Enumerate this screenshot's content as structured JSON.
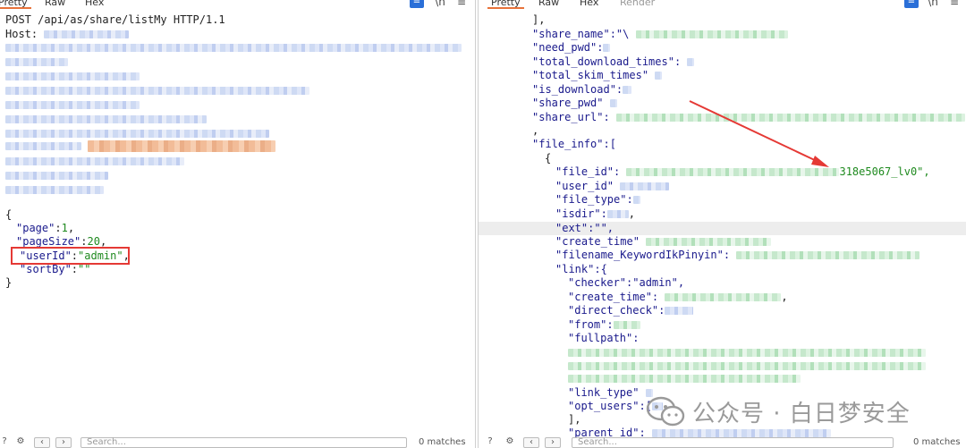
{
  "left_pane": {
    "tabs": [
      "Pretty",
      "Raw",
      "Hex"
    ],
    "active_tab": "Pretty",
    "request_line": "POST /api/as/share/listMy HTTP/1.1",
    "host_label": "Host:",
    "body": {
      "open_brace": "{",
      "close_brace": "}",
      "fields": [
        {
          "key": "\"page\"",
          "sep": ":",
          "value": "1",
          "tail": ","
        },
        {
          "key": "\"pageSize\"",
          "sep": ":",
          "value": "20",
          "tail": ","
        },
        {
          "key": "\"userId\"",
          "sep": ":",
          "value": "\"admin\"",
          "tail": ","
        },
        {
          "key": "\"sortBy\"",
          "sep": ":",
          "value": "\"\"",
          "tail": ""
        }
      ]
    },
    "search_placeholder": "Search...",
    "matches_label": "0 matches"
  },
  "right_pane": {
    "tabs": [
      "Pretty",
      "Raw",
      "Hex",
      "Render"
    ],
    "active_tab": "Pretty",
    "lines": {
      "l01": "],",
      "l02": "\"share_name\":\"\\",
      "l03": "\"need_pwd\":",
      "l04": "\"total_download_times\":",
      "l05": "\"total_skim_times\"",
      "l06": "\"is_download\":",
      "l07": "\"share_pwd\"",
      "l08": "\"share_url\":",
      "l09": ",",
      "l10": "\"file_info\":[",
      "l11": "{",
      "l12": "\"file_id\":",
      "l12_tail": "318e5067_lv0\",",
      "l13": "\"user_id\"",
      "l14": "\"file_type\":",
      "l15": "\"isdir\":",
      "l15_tail": ",",
      "l16": "\"ext\":\"\",",
      "l17": "\"create_time\"",
      "l18": "\"filename_KeywordIkPinyin\":",
      "l19": "\"link\":{",
      "l20": "\"checker\":\"admin\",",
      "l21": "\"create_time\":",
      "l21_tail": ",",
      "l22": "\"direct_check\":",
      "l23": "\"from\":",
      "l24": "\"fullpath\":",
      "l25": "\"link_type\"",
      "l26": "\"opt_users\":[",
      "l27": "],",
      "l28": "\"parent_id\":"
    },
    "matches_label": "0 matches",
    "search_placeholder": "Search..."
  },
  "watermark": {
    "text": "公众号 · 白日梦安全"
  },
  "colors": {
    "accent_tab": "#e8733a",
    "red_annotation": "#e53935",
    "key_blue": "#1a1a8c",
    "value_green": "#1f8a1f"
  }
}
